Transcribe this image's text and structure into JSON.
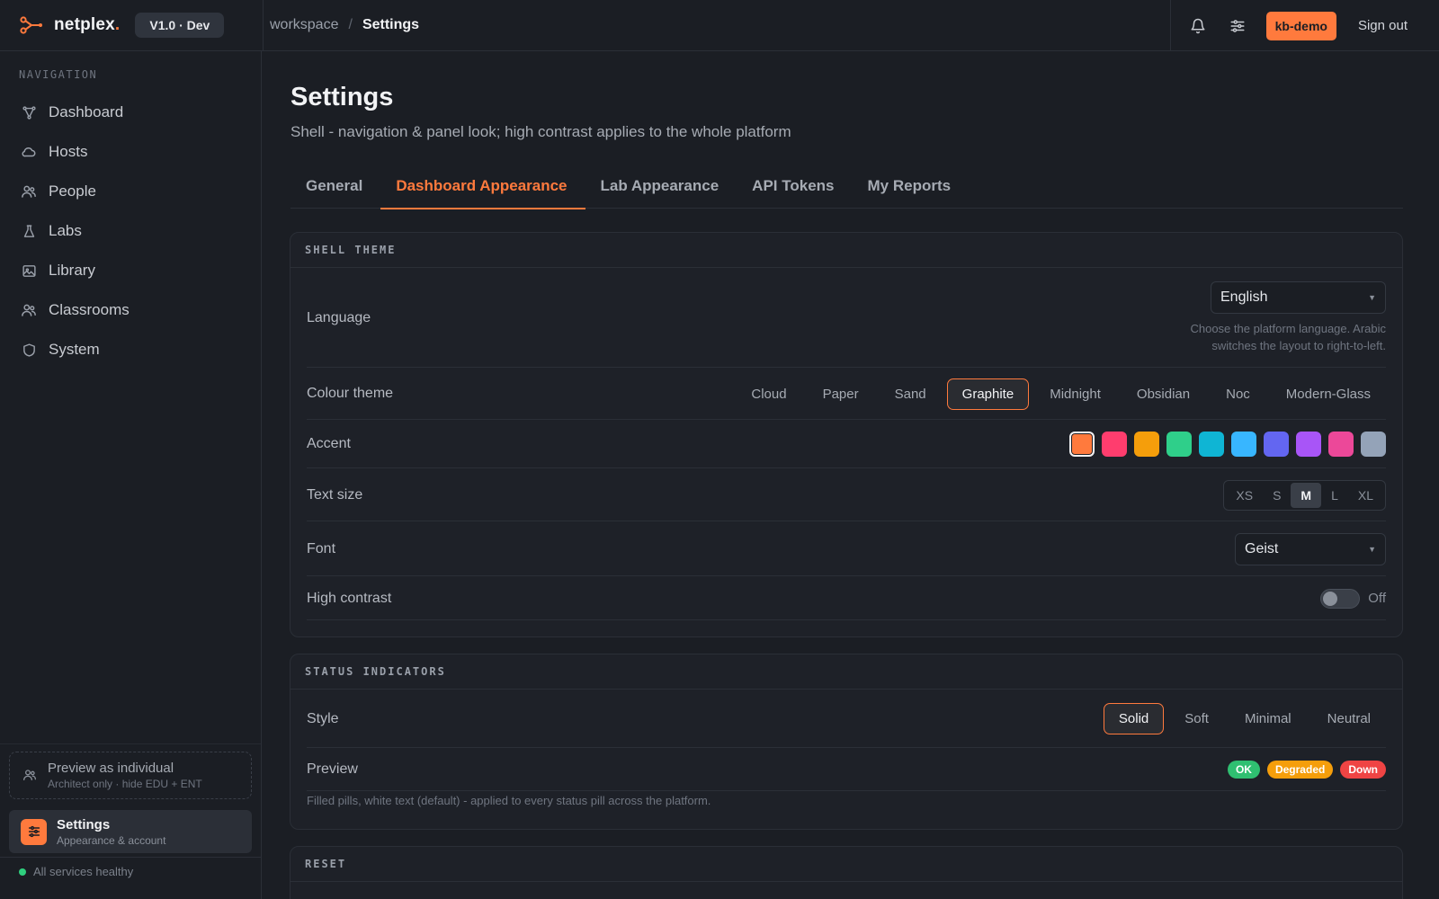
{
  "brand": {
    "name": "netplex",
    "dot": ".",
    "version": "V1.0 · Dev"
  },
  "breadcrumb": {
    "parent": "workspace",
    "separator": "/",
    "current": "Settings"
  },
  "topbar": {
    "user": "kb-demo",
    "sign_out": "Sign out"
  },
  "sidebar": {
    "heading": "NAVIGATION",
    "items": [
      {
        "label": "Dashboard",
        "icon": "dashboard-icon"
      },
      {
        "label": "Hosts",
        "icon": "cloud-icon"
      },
      {
        "label": "People",
        "icon": "people-icon"
      },
      {
        "label": "Labs",
        "icon": "flask-icon"
      },
      {
        "label": "Library",
        "icon": "image-icon"
      },
      {
        "label": "Classrooms",
        "icon": "classroom-icon"
      },
      {
        "label": "System",
        "icon": "shield-icon"
      }
    ],
    "preview": {
      "title": "Preview as individual",
      "subtitle": "Architect only · hide EDU + ENT"
    },
    "settings_card": {
      "title": "Settings",
      "subtitle": "Appearance & account"
    },
    "status": "All services healthy"
  },
  "page": {
    "title": "Settings",
    "subtitle": "Shell - navigation & panel look; high contrast applies to the whole platform",
    "tabs": [
      {
        "label": "General"
      },
      {
        "label": "Dashboard Appearance",
        "active": true
      },
      {
        "label": "Lab Appearance"
      },
      {
        "label": "API Tokens"
      },
      {
        "label": "My Reports"
      }
    ]
  },
  "shell_theme": {
    "heading": "SHELL THEME",
    "language": {
      "label": "Language",
      "value": "English",
      "helper_line1": "Choose the platform language. Arabic",
      "helper_line2": "switches the layout to right-to-left."
    },
    "colour_theme": {
      "label": "Colour theme",
      "options": [
        "Cloud",
        "Paper",
        "Sand",
        "Graphite",
        "Midnight",
        "Obsidian",
        "Noc",
        "Modern-Glass"
      ],
      "selected": "Graphite"
    },
    "accent": {
      "label": "Accent",
      "colors": [
        "#ff7a3d",
        "#ff3d6e",
        "#f59e0b",
        "#2fcf8a",
        "#0fb5d4",
        "#38b6ff",
        "#6366f1",
        "#a855f7",
        "#ec4899",
        "#94a3b8"
      ],
      "selected_index": 0
    },
    "text_size": {
      "label": "Text size",
      "options": [
        "XS",
        "S",
        "M",
        "L",
        "XL"
      ],
      "selected": "M"
    },
    "font": {
      "label": "Font",
      "value": "Geist"
    },
    "high_contrast": {
      "label": "High contrast",
      "state": "Off"
    }
  },
  "status_indicators": {
    "heading": "STATUS INDICATORS",
    "style": {
      "label": "Style",
      "options": [
        "Solid",
        "Soft",
        "Minimal",
        "Neutral"
      ],
      "selected": "Solid"
    },
    "preview": {
      "label": "Preview",
      "pills": [
        {
          "text": "OK",
          "color": "#2fbf71"
        },
        {
          "text": "Degraded",
          "color": "#f59e0b"
        },
        {
          "text": "Down",
          "color": "#ef4444"
        }
      ]
    },
    "footnote": "Filled pills, white text (default) - applied to every status pill across the platform."
  },
  "reset": {
    "heading": "RESET"
  },
  "colors": {
    "accent": "#ff7a3d",
    "background": "#1b1e24",
    "panel": "#1e2128"
  }
}
